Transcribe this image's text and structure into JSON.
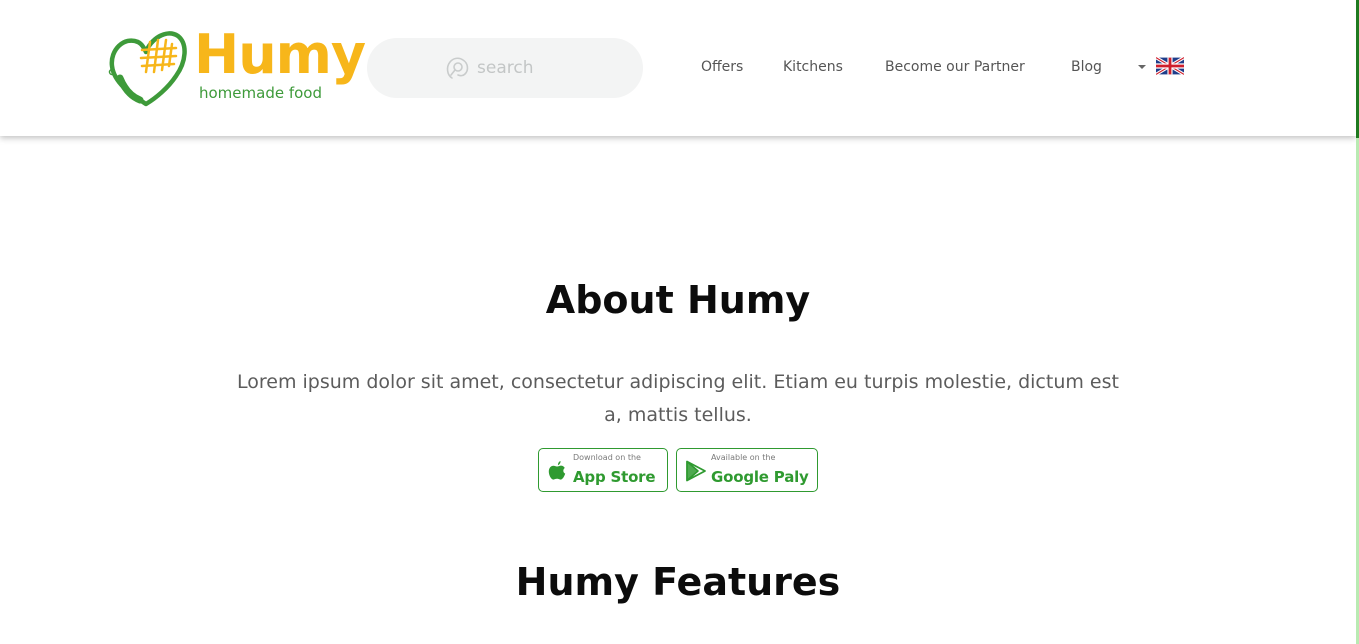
{
  "header": {
    "logo": {
      "wordmark": "Humy",
      "tagline": "homemade food",
      "icon": "chef-hat-heart-icon"
    },
    "search": {
      "placeholder": "search",
      "icon": "search-icon"
    },
    "nav": {
      "items": [
        {
          "label": "Offers"
        },
        {
          "label": "Kitchens"
        },
        {
          "label": "Become our Partner"
        },
        {
          "label": "Blog"
        }
      ],
      "language": {
        "icon": "uk-flag-icon",
        "dropdown_icon": "caret-down-icon"
      }
    }
  },
  "about": {
    "title": "About Humy",
    "text": "Lorem ipsum dolor sit amet, consectetur adipiscing elit. Etiam eu turpis molestie, dictum est a, mattis tellus.",
    "stores": [
      {
        "small": "Download on the",
        "big": "App Store",
        "icon": "apple-icon"
      },
      {
        "small": "Available on the",
        "big": "Google Paly",
        "icon": "google-play-icon"
      }
    ]
  },
  "features": {
    "title": "Humy Features"
  },
  "colors": {
    "brand_yellow": "#f7b61a",
    "brand_green": "#3e9a3a",
    "button_green": "#2f9a30",
    "search_bg": "#f3f4f4",
    "heading": "#0c0c0c",
    "body_text": "#5c5c5c"
  }
}
